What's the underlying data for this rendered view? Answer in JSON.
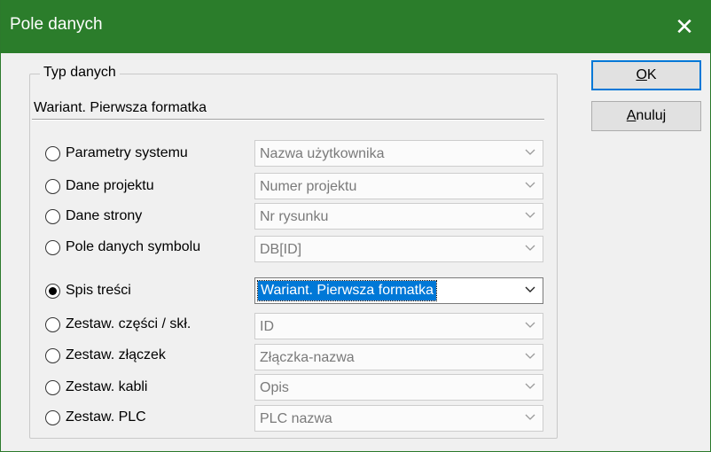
{
  "dialog": {
    "title": "Pole danych",
    "close_label": "✕"
  },
  "group": {
    "title": "Typ danych",
    "variant_label": "Wariant. Pierwsza formatka"
  },
  "options": [
    {
      "label": "Parametry systemu",
      "value": "Nazwa użytkownika",
      "checked": false
    },
    {
      "label": "Dane projektu",
      "value": "Numer projektu",
      "checked": false
    },
    {
      "label": "Dane strony",
      "value": "Nr rysunku",
      "checked": false
    },
    {
      "label": "Pole danych symbolu",
      "value": "DB[ID]",
      "checked": false
    },
    {
      "label": "Spis treści",
      "value": "Wariant. Pierwsza formatka",
      "checked": true
    },
    {
      "label": "Zestaw. części / skł.",
      "value": "ID",
      "checked": false
    },
    {
      "label": "Zestaw. złączek",
      "value": "Złączka-nazwa",
      "checked": false
    },
    {
      "label": "Zestaw. kabli",
      "value": "Opis",
      "checked": false
    },
    {
      "label": "Zestaw. PLC",
      "value": "PLC nazwa",
      "checked": false
    }
  ],
  "buttons": {
    "ok": {
      "mnemonic": "O",
      "rest": "K"
    },
    "cancel": {
      "mnemonic": "A",
      "rest": "nuluj"
    }
  }
}
